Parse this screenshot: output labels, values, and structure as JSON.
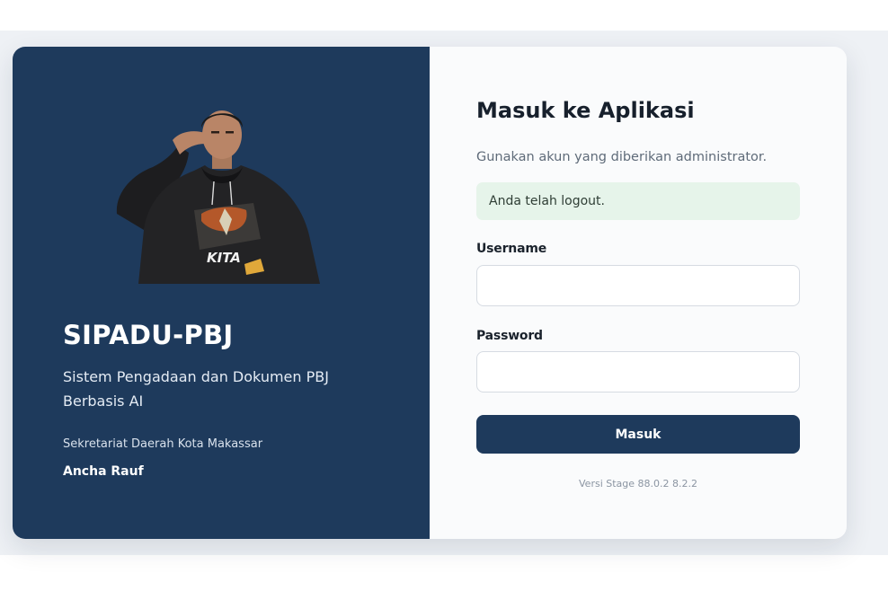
{
  "brand": {
    "title": "SIPADU-PBJ",
    "subtitle": "Sistem Pengadaan dan Dokumen PBJ Berbasis AI",
    "organization": "Sekretariat Daerah Kota Makassar",
    "user_name": "Ancha Rauf",
    "photo_shirt_text": "KITA",
    "panel_color": "#1e3a5c"
  },
  "login": {
    "title": "Masuk ke Aplikasi",
    "hint": "Gunakan akun yang diberikan administrator.",
    "alert_message": "Anda telah logout.",
    "alert_color": "#e6f4ea",
    "username_label": "Username",
    "username_value": "",
    "password_label": "Password",
    "password_value": "",
    "submit_label": "Masuk",
    "button_color": "#1e3a5c",
    "version": "Versi Stage 88.0.2 8.2.2"
  }
}
